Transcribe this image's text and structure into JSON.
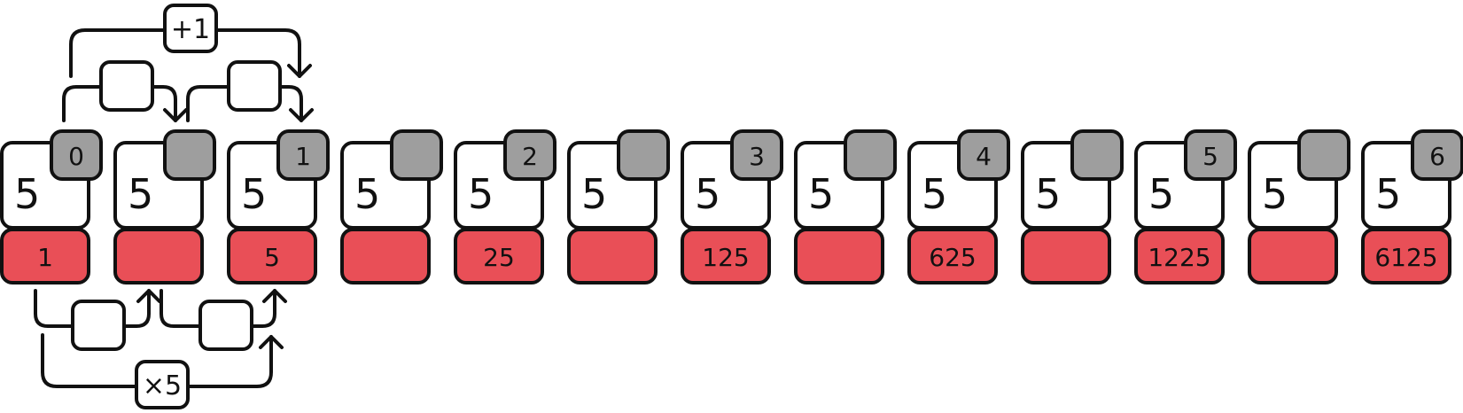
{
  "colors": {
    "stroke": "#111111",
    "card_fill": "#ffffff",
    "index_badge_fill": "#9e9e9e",
    "value_fill": "#e94f57",
    "operator_fill": "#ffffff"
  },
  "cells": [
    {
      "digit": "5",
      "index": "0",
      "value": "1"
    },
    {
      "digit": "5",
      "index": "",
      "value": ""
    },
    {
      "digit": "5",
      "index": "1",
      "value": "5"
    },
    {
      "digit": "5",
      "index": "",
      "value": ""
    },
    {
      "digit": "5",
      "index": "2",
      "value": "25"
    },
    {
      "digit": "5",
      "index": "",
      "value": ""
    },
    {
      "digit": "5",
      "index": "3",
      "value": "125"
    },
    {
      "digit": "5",
      "index": "",
      "value": ""
    },
    {
      "digit": "5",
      "index": "4",
      "value": "625"
    },
    {
      "digit": "5",
      "index": "",
      "value": ""
    },
    {
      "digit": "5",
      "index": "5",
      "value": "1225"
    },
    {
      "digit": "5",
      "index": "",
      "value": ""
    },
    {
      "digit": "5",
      "index": "6",
      "value": "6125"
    }
  ],
  "operators": {
    "increment_label": "+1",
    "multiply_label": "×5",
    "top_step_blank_1": "",
    "top_step_blank_2": "",
    "bottom_step_blank_1": "",
    "bottom_step_blank_2": ""
  }
}
